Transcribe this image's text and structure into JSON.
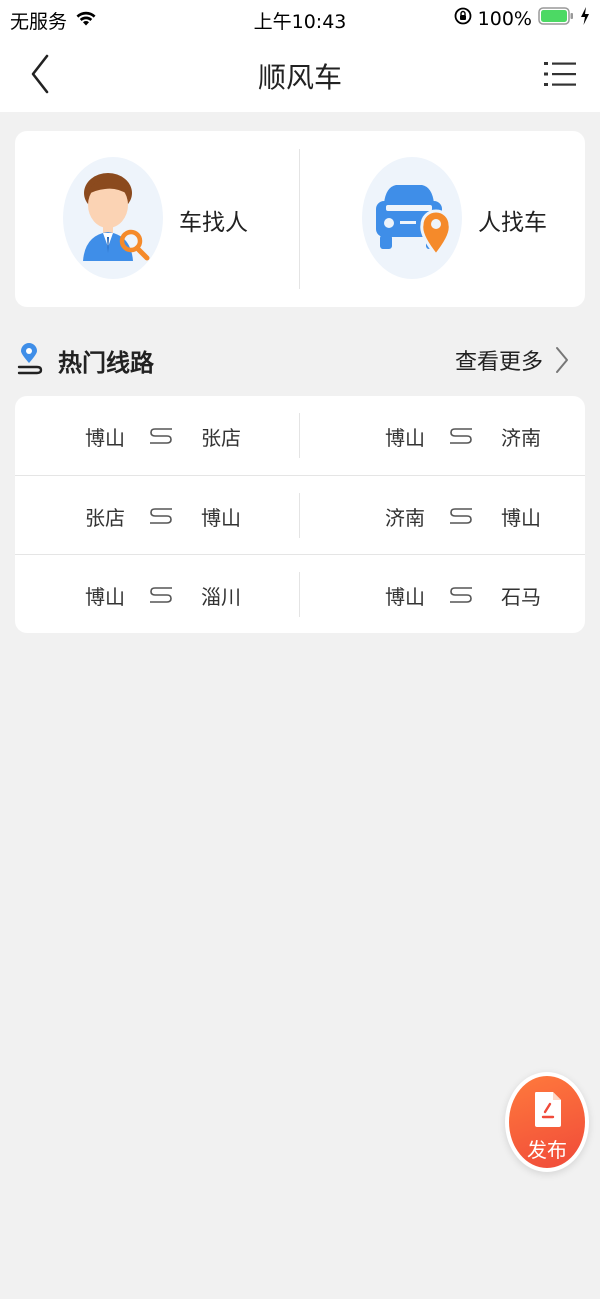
{
  "status_bar": {
    "carrier": "无服务",
    "time": "上午10:43",
    "battery": "100%"
  },
  "nav": {
    "title": "顺风车"
  },
  "top_card": {
    "car_find_people": "车找人",
    "people_find_car": "人找车"
  },
  "hot_routes": {
    "title": "热门线路",
    "more": "查看更多",
    "rows": [
      [
        {
          "from": "博山",
          "to": "张店"
        },
        {
          "from": "博山",
          "to": "济南"
        }
      ],
      [
        {
          "from": "张店",
          "to": "博山"
        },
        {
          "from": "济南",
          "to": "博山"
        }
      ],
      [
        {
          "from": "博山",
          "to": "淄川"
        },
        {
          "from": "博山",
          "to": "石马"
        }
      ]
    ]
  },
  "fab": {
    "label": "发布"
  },
  "colors": {
    "accent_blue": "#3f8ee8",
    "accent_orange": "#f58a2a",
    "fab_start": "#ff7a3c",
    "fab_end": "#f04a3a",
    "battery_green": "#4cd964"
  }
}
